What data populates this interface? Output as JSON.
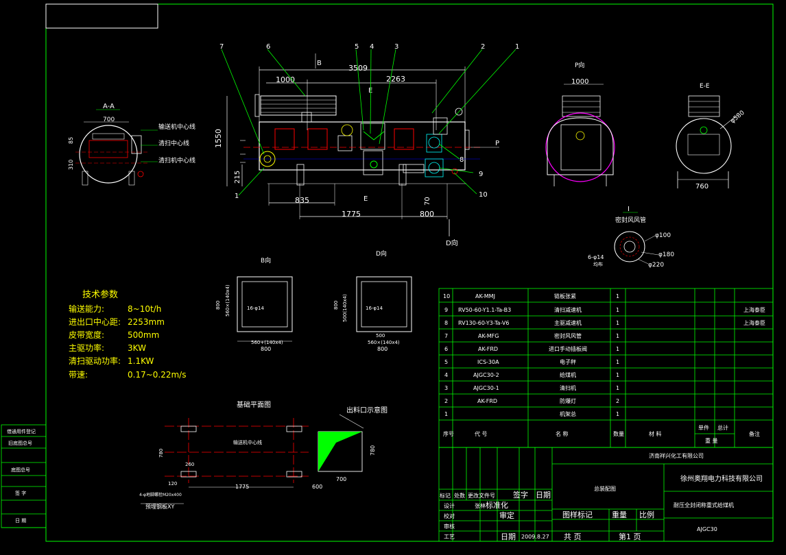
{
  "colors": {
    "background": "#000000",
    "frame": "#00ff00",
    "line_white": "#ffffff",
    "red": "#ff0000",
    "blue": "#0000ff",
    "magenta": "#ff00ff",
    "cyan": "#00ffff",
    "yellow": "#ffff00"
  },
  "views": {
    "main": {
      "dims_top": [
        "3509",
        "1000",
        "2263"
      ],
      "dims_bottom": [
        "835",
        "1775",
        "800",
        "70"
      ],
      "dims_left": [
        "1550",
        "215"
      ],
      "callouts": [
        "7",
        "6",
        "5",
        "4",
        "3",
        "2",
        "1",
        "8",
        "9",
        "10",
        "1"
      ],
      "section_marks": [
        "B",
        "E",
        "E",
        "P",
        "D向"
      ]
    },
    "aa": {
      "title": "A-A",
      "dim_width": "700",
      "dim_h1": "85",
      "dim_h2": "310",
      "labels": [
        "输送机中心线",
        "清扫中心线",
        "清扫机中心线"
      ]
    },
    "p": {
      "title": "P向",
      "dim": "1000"
    },
    "ee": {
      "title": "E-E",
      "dim": "760",
      "dia": "φ580"
    },
    "detail_i": {
      "title": "I",
      "subtitle": "密封风风管",
      "dims": [
        "φ100",
        "φ180",
        "φ220",
        "6-φ14",
        "均布"
      ]
    },
    "b": {
      "title": "B向",
      "dims": [
        "800",
        "560",
        "560×(140x4)",
        "16-φ14",
        "560+(140x4)"
      ]
    },
    "d": {
      "title": "D向",
      "dims": [
        "800",
        "500(140x4)",
        "560×(140x4)",
        "16-φ14",
        "500"
      ]
    },
    "plan": {
      "title": "基础平面图",
      "label_center": "输送机中心线",
      "dims": [
        "780",
        "1775",
        "600",
        "260",
        "120"
      ],
      "note1": "4-φ地脚螺栓M20x400",
      "note2": "预埋钢板XY"
    },
    "outlet": {
      "title": "出料口示意图",
      "dims": [
        "780",
        "700"
      ]
    }
  },
  "tech": {
    "title": "技术参数",
    "rows": [
      {
        "label": "输送能力:",
        "value": "8~10t/h"
      },
      {
        "label": "进出口中心距:",
        "value": "2253mm"
      },
      {
        "label": "皮带宽度:",
        "value": "500mm"
      },
      {
        "label": "主驱功率:",
        "value": "3KW"
      },
      {
        "label": "清扫驱动功率:",
        "value": "1.1KW"
      },
      {
        "label": "带速:",
        "value": "0.17~0.22m/s"
      }
    ]
  },
  "left_stamp": [
    "借通用件登记",
    "旧底图总号",
    "底图总号",
    "签 字",
    "日 期"
  ],
  "bom": {
    "rows": [
      {
        "no": "10",
        "code": "AK-MMJ",
        "name": "链板张紧",
        "qty": "1",
        "mat": "",
        "w1": "",
        "w2": "",
        "note": ""
      },
      {
        "no": "9",
        "code": "RV50-60-Y1.1-Ta-B3",
        "name": "清扫减速机",
        "qty": "1",
        "mat": "",
        "w1": "",
        "w2": "",
        "note": "上海泰臣"
      },
      {
        "no": "8",
        "code": "RV130-60-Y3-Ta-V6",
        "name": "主驱减速机",
        "qty": "1",
        "mat": "",
        "w1": "",
        "w2": "",
        "note": "上海泰臣"
      },
      {
        "no": "7",
        "code": "AK-MFG",
        "name": "密封风风管",
        "qty": "1",
        "mat": "",
        "w1": "",
        "w2": "",
        "note": ""
      },
      {
        "no": "6",
        "code": "AK-FRD",
        "name": "进口手动插板阀",
        "qty": "1",
        "mat": "",
        "w1": "",
        "w2": "",
        "note": ""
      },
      {
        "no": "5",
        "code": "ICS-30A",
        "name": "电子秤",
        "qty": "1",
        "mat": "",
        "w1": "",
        "w2": "",
        "note": ""
      },
      {
        "no": "4",
        "code": "AJGC30-2",
        "name": "给煤机",
        "qty": "1",
        "mat": "",
        "w1": "",
        "w2": "",
        "note": ""
      },
      {
        "no": "3",
        "code": "AJGC30-1",
        "name": "清扫机",
        "qty": "1",
        "mat": "",
        "w1": "",
        "w2": "",
        "note": ""
      },
      {
        "no": "2",
        "code": "AK-FRD",
        "name": "防爆灯",
        "qty": "2",
        "mat": "",
        "w1": "",
        "w2": "",
        "note": ""
      },
      {
        "no": "1",
        "code": "",
        "name": "机架总",
        "qty": "1",
        "mat": "",
        "w1": "",
        "w2": "",
        "note": ""
      }
    ],
    "header": {
      "no": "序号",
      "code": "代 号",
      "name": "名 称",
      "qty": "数量",
      "mat": "材 料",
      "single": "单件",
      "total": "总计",
      "weight": "重 量",
      "note": "备注"
    }
  },
  "title_block": {
    "company1": "济南祥兴化工有限公司",
    "company2": "徐州奥翔电力科技有限公司",
    "drawing": "总装配图",
    "product": "耐压全封闭称重式给煤机",
    "code": "AJGC30",
    "row_labels": [
      "标记",
      "处数",
      "更改文件号",
      "签字",
      "日期"
    ],
    "design": "设计",
    "design_name": "张林",
    "standard": "标准化",
    "check": "校对",
    "review": "审定",
    "audit": "审核",
    "craft": "工艺",
    "date_label": "日期",
    "date_value": "2009.8.27",
    "stage": "图样标记",
    "weight": "重量",
    "scale": "比例",
    "total_pages": "共 页",
    "page": "第1 页"
  }
}
